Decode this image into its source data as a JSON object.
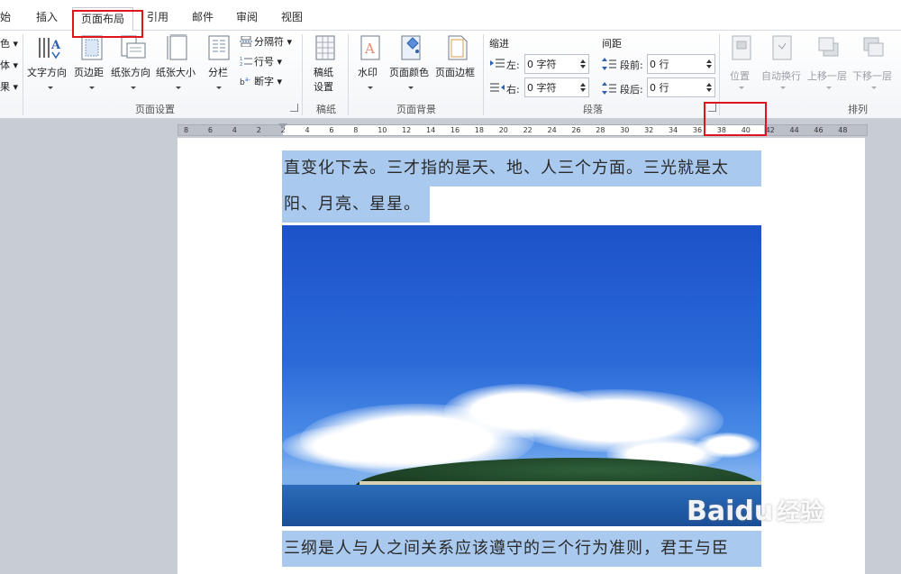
{
  "tabs": [
    {
      "label": "始"
    },
    {
      "label": "插入"
    },
    {
      "label": "页面布局"
    },
    {
      "label": "引用"
    },
    {
      "label": "邮件"
    },
    {
      "label": "审阅"
    },
    {
      "label": "视图"
    }
  ],
  "active_tab": "页面布局",
  "left_cut": {
    "item1": "色",
    "item2": "体",
    "item3": "果"
  },
  "page_setup": {
    "group_label": "页面设置",
    "text_direction": "文字方向",
    "margins": "页边距",
    "orientation": "纸张方向",
    "size": "纸张大小",
    "columns": "分栏",
    "breaks": "分隔符",
    "line_numbers": "行号",
    "hyphenation": "断字"
  },
  "manuscript": {
    "group_label": "稿纸",
    "button_line1": "稿纸",
    "button_line2": "设置"
  },
  "page_background": {
    "group_label": "页面背景",
    "watermark": "水印",
    "page_color": "页面颜色",
    "page_borders": "页面边框"
  },
  "paragraph": {
    "group_label": "段落",
    "indent_title": "缩进",
    "left_label": "左:",
    "left_value": "0 字符",
    "right_label": "右:",
    "right_value": "0 字符",
    "spacing_title": "间距",
    "before_label": "段前:",
    "before_value": "0 行",
    "after_label": "段后:",
    "after_value": "0 行"
  },
  "arrange": {
    "group_label": "排列",
    "position": "位置",
    "wrap_text": "自动换行",
    "bring_forward": "上移一层",
    "send_backward": "下移一层"
  },
  "ruler_numbers": [
    "8",
    "6",
    "4",
    "2",
    "2",
    "4",
    "6",
    "8",
    "10",
    "12",
    "14",
    "16",
    "18",
    "20",
    "22",
    "24",
    "26",
    "28",
    "30",
    "32",
    "34",
    "36",
    "38",
    "40",
    "42",
    "44",
    "46",
    "48"
  ],
  "document": {
    "line1": "直变化下去。三才指的是天、地、人三个方面。三光就是太",
    "line2": "阳、月亮、星星。",
    "line3": "三纲是人与人之间关系应该遵守的三个行为准则，君王与臣"
  },
  "watermark": {
    "brand": "Baidu",
    "cn": "经验"
  },
  "colors": {
    "highlight": "#a9c9ee",
    "red_annotation": "#e0141b",
    "sky": "#2a6ad8"
  }
}
